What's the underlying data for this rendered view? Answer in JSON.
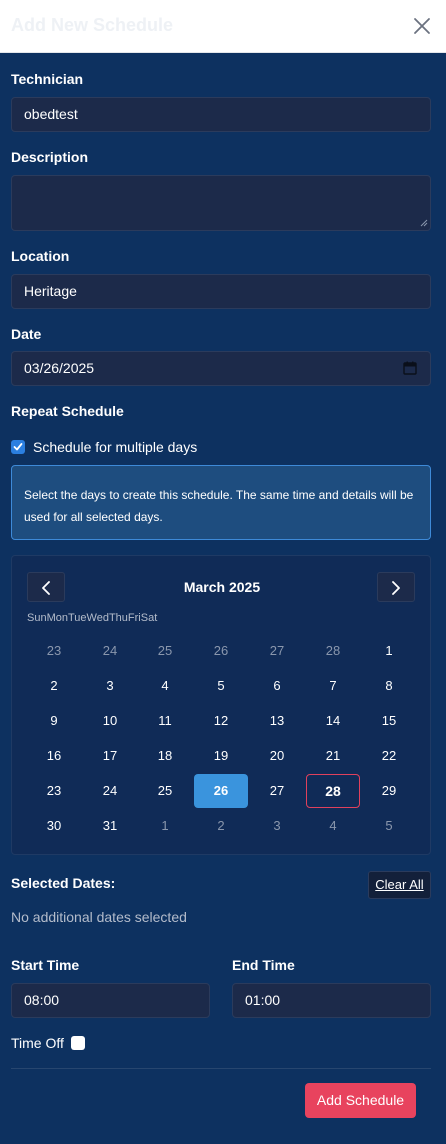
{
  "modal": {
    "title": "Add New Schedule",
    "close_icon": "close-icon"
  },
  "form": {
    "technician_label": "Technician",
    "technician_value": "obedtest",
    "description_label": "Description",
    "description_value": "",
    "location_label": "Location",
    "location_value": "Heritage",
    "date_label": "Date",
    "date_value": "03/26/2025",
    "repeat_label": "Repeat Schedule",
    "multiple_days_label": "Schedule for multiple days",
    "multiple_days_checked": true,
    "info_text": "Select the days to create this schedule. The same time and details will be used for all selected days."
  },
  "calendar": {
    "month_label": "March 2025",
    "prev_icon": "chevron-left-icon",
    "next_icon": "chevron-right-icon",
    "weekdays": [
      "Sun",
      "Mon",
      "Tue",
      "Wed",
      "Thu",
      "Fri",
      "Sat"
    ],
    "weeks": [
      [
        {
          "d": "23",
          "m": true
        },
        {
          "d": "24",
          "m": true
        },
        {
          "d": "25",
          "m": true
        },
        {
          "d": "26",
          "m": true
        },
        {
          "d": "27",
          "m": true
        },
        {
          "d": "28",
          "m": true
        },
        {
          "d": "1"
        }
      ],
      [
        {
          "d": "2"
        },
        {
          "d": "3"
        },
        {
          "d": "4"
        },
        {
          "d": "5"
        },
        {
          "d": "6"
        },
        {
          "d": "7"
        },
        {
          "d": "8"
        }
      ],
      [
        {
          "d": "9"
        },
        {
          "d": "10"
        },
        {
          "d": "11"
        },
        {
          "d": "12"
        },
        {
          "d": "13"
        },
        {
          "d": "14"
        },
        {
          "d": "15"
        }
      ],
      [
        {
          "d": "16"
        },
        {
          "d": "17"
        },
        {
          "d": "18"
        },
        {
          "d": "19"
        },
        {
          "d": "20"
        },
        {
          "d": "21"
        },
        {
          "d": "22"
        }
      ],
      [
        {
          "d": "23"
        },
        {
          "d": "24"
        },
        {
          "d": "25"
        },
        {
          "d": "26",
          "selected": true
        },
        {
          "d": "27"
        },
        {
          "d": "28",
          "today": true
        },
        {
          "d": "29"
        }
      ],
      [
        {
          "d": "30"
        },
        {
          "d": "31"
        },
        {
          "d": "1",
          "m": true
        },
        {
          "d": "2",
          "m": true
        },
        {
          "d": "3",
          "m": true
        },
        {
          "d": "4",
          "m": true
        },
        {
          "d": "5",
          "m": true
        }
      ]
    ]
  },
  "selected_dates": {
    "label": "Selected Dates:",
    "clear_label": "Clear All",
    "empty_text": "No additional dates selected"
  },
  "times": {
    "start_label": "Start Time",
    "start_value": "08:00",
    "end_label": "End Time",
    "end_value": "01:00",
    "time_off_label": "Time Off",
    "time_off_checked": false
  },
  "actions": {
    "submit_label": "Add Schedule"
  },
  "colors": {
    "background": "#0d3160",
    "accent": "#3a94dd",
    "submit": "#e8435e",
    "today_border": "#e0415d"
  }
}
